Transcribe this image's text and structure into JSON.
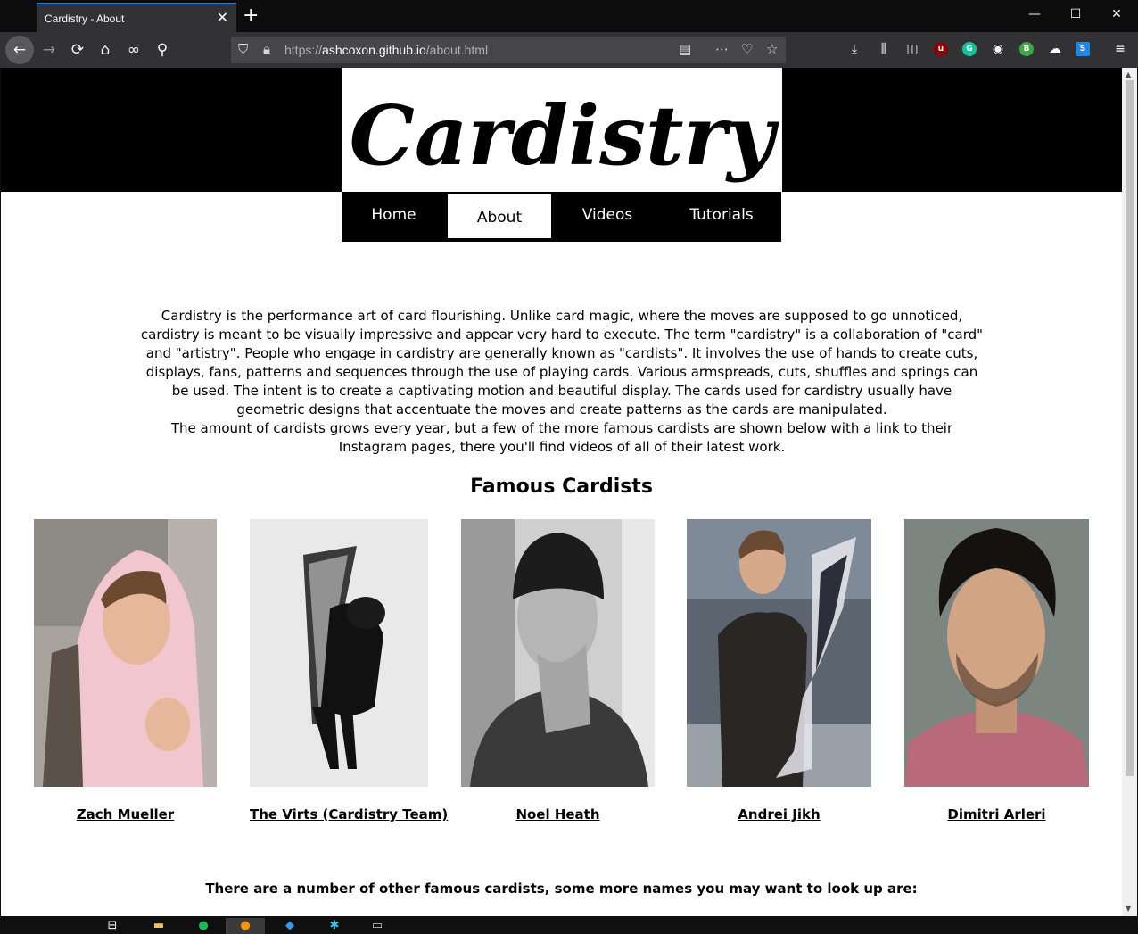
{
  "browser": {
    "tab_title": "Cardistry - About",
    "tab_close": "✕",
    "new_tab": "+",
    "window_controls": {
      "minimize": "—",
      "maximize": "☐",
      "close": "✕"
    },
    "url_scheme": "https://",
    "url_host": "ashcoxon.github.io",
    "url_path": "/about.html",
    "nav_icons": [
      "back-arrow-icon",
      "forward-arrow-icon",
      "reload-icon",
      "home-icon",
      "mask-icon",
      "wrench-icon"
    ],
    "toolbar_icons": [
      "download-icon",
      "library-icon",
      "sidebar-icon",
      "ublock-icon",
      "grammarly-icon",
      "account-icon",
      "bplus-icon",
      "extension-icon",
      "s-extension-icon",
      "menu-icon"
    ],
    "colors": {
      "tab_accent": "#0a84ff",
      "chrome_bg": "#323234",
      "titlebar_bg": "#0c0c0d"
    }
  },
  "site": {
    "logo_text": "Cardistry",
    "nav": [
      {
        "label": "Home",
        "active": false
      },
      {
        "label": "About",
        "active": true
      },
      {
        "label": "Videos",
        "active": false
      },
      {
        "label": "Tutorials",
        "active": false
      }
    ],
    "intro_lines": [
      "Cardistry is the performance art of card flourishing. Unlike card magic, where the moves are supposed to go unnoticed,",
      "cardistry is meant to be visually impressive and appear very hard to execute. The term \"cardistry\" is a collaboration of \"card\"",
      "and \"artistry\". People who engage in cardistry are generally known as \"cardists\". It involves the use of hands to create cuts,",
      "displays, fans, patterns and sequences through the use of playing cards. Various armspreads, cuts, shuffles and springs can",
      "be used. The intent is to create a captivating motion and beautiful display. The cards used for cardistry usually have",
      "geometric designs that accentuate the moves and create patterns as the cards are manipulated.",
      "The amount of cardists grows every year, but a few of the more famous cardists are shown below with a link to their",
      "Instagram pages, there you'll find videos of all of their latest work."
    ],
    "section_title": "Famous Cardists",
    "cardists": [
      {
        "name": "Zach Mueller"
      },
      {
        "name": "The Virts (Cardistry Team)"
      },
      {
        "name": "Noel Heath"
      },
      {
        "name": "Andrei Jikh"
      },
      {
        "name": "Dimitri Arleri"
      }
    ],
    "footnote": "There are a number of other famous cardists, some more names you may want to look up are:"
  },
  "taskbar": {
    "icons": [
      "task-view-icon",
      "file-explorer-icon",
      "spotify-icon",
      "firefox-icon",
      "vscode-icon",
      "slack-icon",
      "terminal-icon"
    ]
  }
}
